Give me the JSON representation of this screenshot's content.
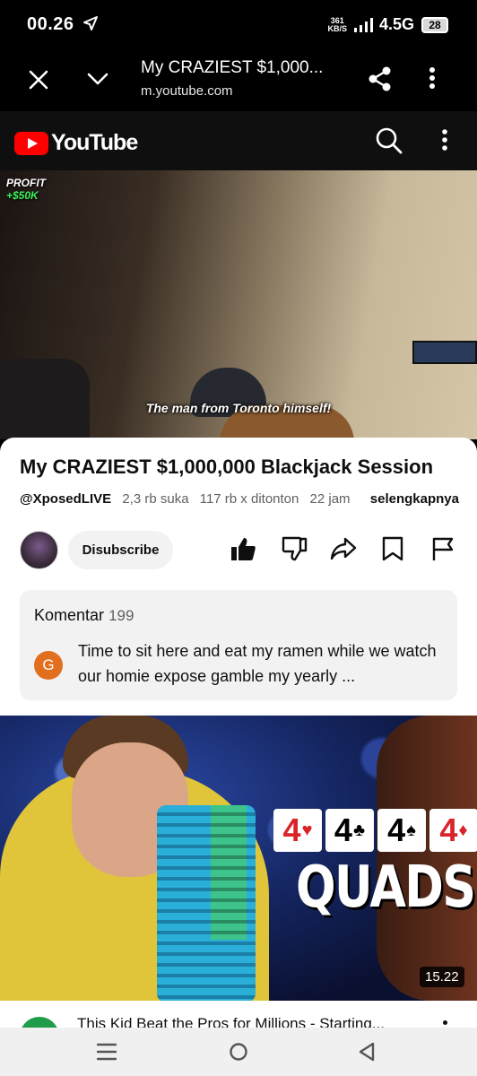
{
  "status": {
    "time": "00.26",
    "speed_value": "361",
    "speed_unit": "KB/S",
    "network": "4.5G",
    "battery": "28"
  },
  "tab": {
    "title": "My CRAZIEST $1,000...",
    "url": "m.youtube.com"
  },
  "header": {
    "logo_text": "YouTube",
    "brand_color": "#ff0000"
  },
  "player": {
    "profit_label": "PROFIT",
    "profit_value": "+$50K",
    "caption": "The man from Toronto himself!"
  },
  "video": {
    "title": "My CRAZIEST $1,000,000 Blackjack Session",
    "channel": "@XposedLIVE",
    "likes": "2,3 rb suka",
    "views": "117 rb x ditonton",
    "time_ago": "22 jam",
    "more_label": "selengkapnya",
    "unsubscribe_label": "Disubscribe"
  },
  "comments": {
    "label": "Komentar",
    "count": "199",
    "avatar_letter": "G",
    "top_comment": "Time to sit here and eat my ramen while we watch our homie expose gamble my yearly ..."
  },
  "next_video": {
    "cards": [
      "4",
      "4",
      "4",
      "4"
    ],
    "overlay_text": "QUADS!",
    "duration": "15.22",
    "title": "This Kid Beat the Pros for Millions - Starting..."
  }
}
